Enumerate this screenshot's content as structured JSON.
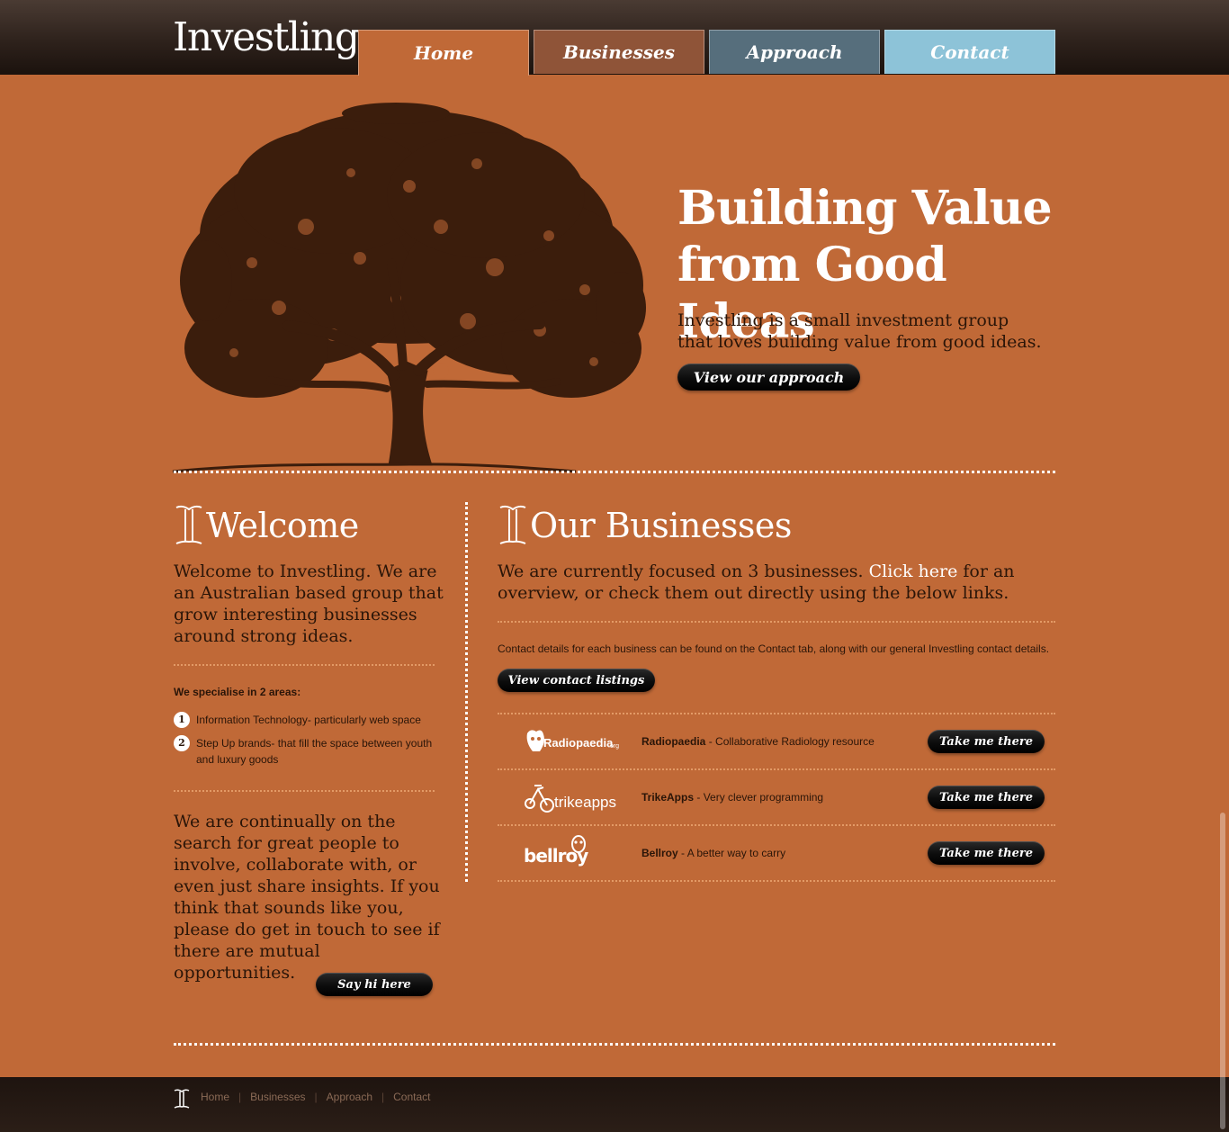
{
  "header": {
    "logo": "Investling",
    "nav": [
      {
        "label": "Home",
        "color": "#c06937"
      },
      {
        "label": "Businesses",
        "color": "#8f5438"
      },
      {
        "label": "Approach",
        "color": "#566e7c"
      },
      {
        "label": "Contact",
        "color": "#8dc3d8"
      }
    ]
  },
  "hero": {
    "title_line1": "Building Value",
    "title_line2": "from Good Ideas",
    "text": "Investling is a small investment group that loves building value from good ideas.",
    "button": "View our approach"
  },
  "welcome": {
    "heading": "Welcome",
    "text": "Welcome to Investling. We are an Australian based group that grow interesting businesses around strong ideas.",
    "specialise_heading": "We specialise in 2 areas:",
    "areas": [
      {
        "number": "1",
        "text": "Information Technology- particularly web space"
      },
      {
        "number": "2",
        "text": "Step Up brands- that fill the space between youth and luxury goods"
      }
    ],
    "search_text": "We are continually on the search for great people to involve, collaborate with, or even just share insights. If you think that sounds like you, please do get in touch to see if there are mutual opportunities.",
    "button": "Say hi here"
  },
  "businesses": {
    "heading": "Our Businesses",
    "intro_before": "We are currently focused on 3 businesses. ",
    "intro_link": "Click here",
    "intro_after": " for an overview, or check them out directly using the below links.",
    "contact_note": "Contact details for each business can be found on the Contact tab, along with our general Investling contact details.",
    "contact_button": "View contact listings",
    "items": [
      {
        "logo_text": "Radiopaedia",
        "logo_suffix": ".org",
        "name": "Radiopaedia",
        "desc": " - Collaborative Radiology resource",
        "button": "Take me there"
      },
      {
        "logo_text": "trikeapps",
        "name": "TrikeApps",
        "desc": " - Very clever programming",
        "button": "Take me there"
      },
      {
        "logo_text": "bellroy",
        "name": "Bellroy",
        "desc": " - A better way to carry",
        "button": "Take me there"
      }
    ]
  },
  "footer": {
    "links": [
      "Home",
      "Businesses",
      "Approach",
      "Contact"
    ]
  },
  "colors": {
    "background": "#c06937",
    "header": "#2e221c",
    "text": "#2a1508",
    "button": "#0c0c0c"
  }
}
